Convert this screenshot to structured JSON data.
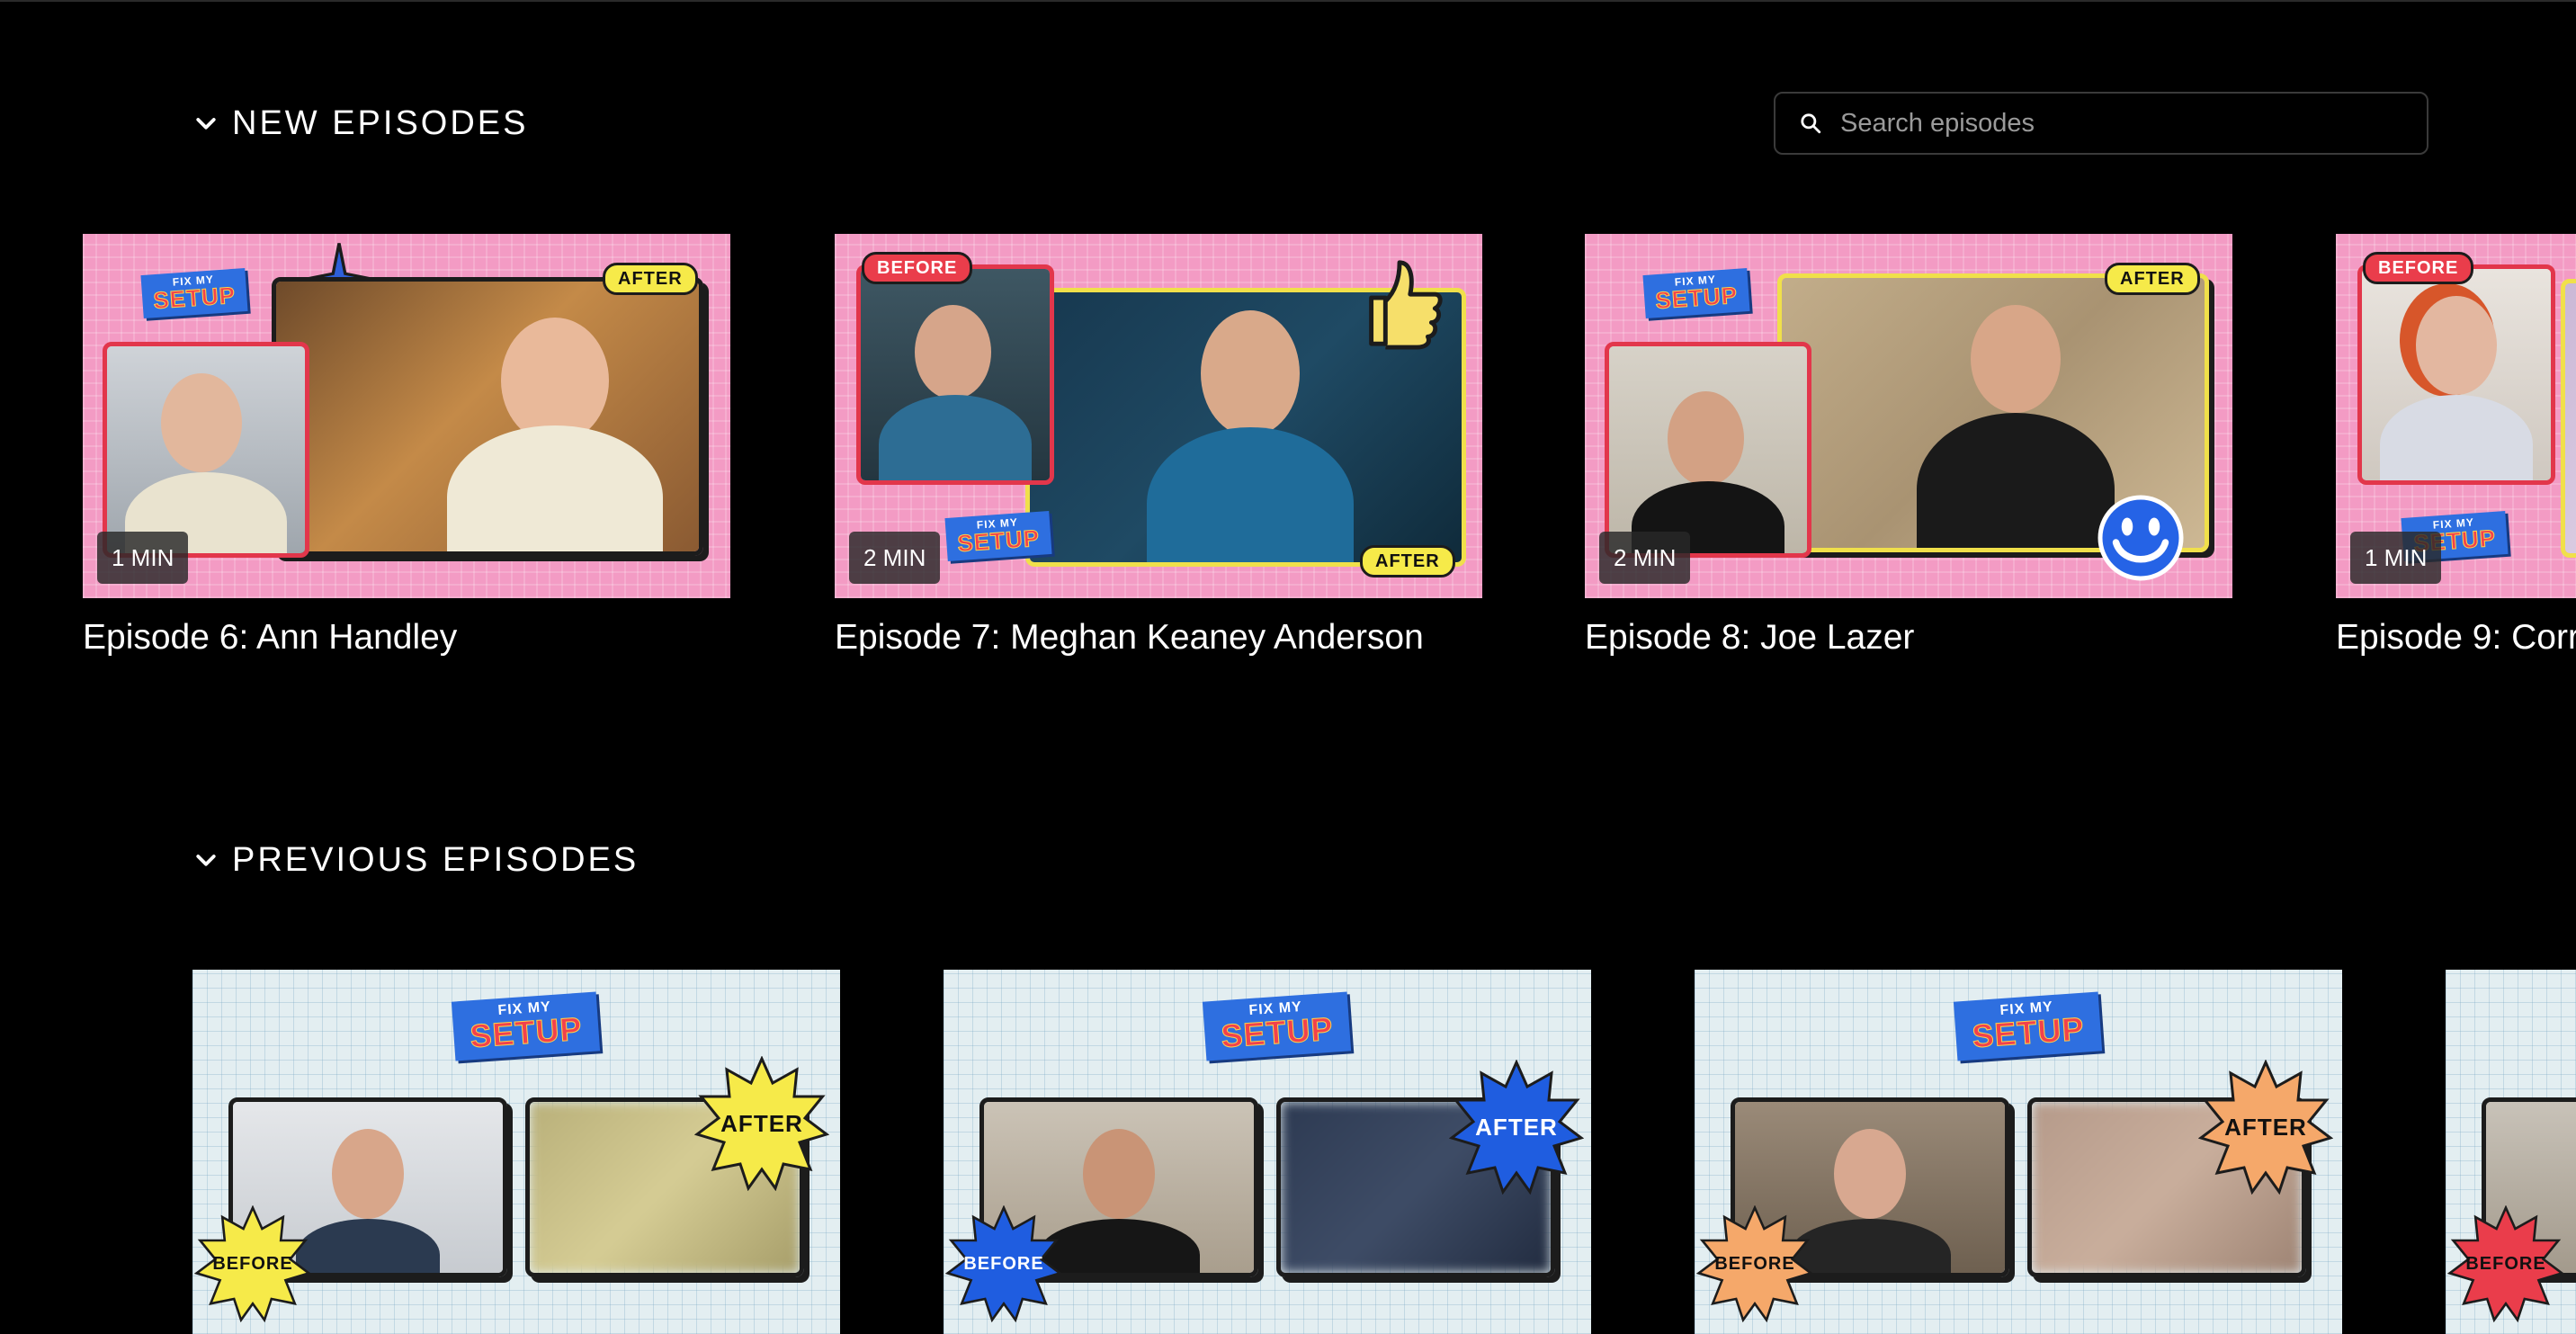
{
  "sections": {
    "new": {
      "title": "NEW EPISODES"
    },
    "previous": {
      "title": "PREVIOUS EPISODES"
    }
  },
  "search": {
    "placeholder": "Search episodes"
  },
  "new_episodes": [
    {
      "title": "Episode 6: Ann Handley",
      "duration": "1 MIN",
      "badge": "AFTER"
    },
    {
      "title": "Episode 7: Meghan Keaney Anderson",
      "duration": "2 MIN",
      "badge_top": "BEFORE",
      "badge_bottom": "AFTER"
    },
    {
      "title": "Episode 8: Joe Lazer",
      "duration": "2 MIN",
      "badge": "AFTER"
    },
    {
      "title": "Episode 9: Corr",
      "duration": "1 MIN",
      "badge": "BEFORE"
    }
  ],
  "previous_episodes": [
    {
      "before": "BEFORE",
      "after": "AFTER"
    },
    {
      "before": "BEFORE",
      "after": "AFTER"
    },
    {
      "before": "BEFORE",
      "after": "AFTER"
    },
    {
      "before": "BEFORE"
    }
  ],
  "logo": {
    "line1": "FIX MY",
    "line2": "SETUP"
  },
  "colors": {
    "background": "#000000",
    "pink": "#f39bc4",
    "after_yellow": "#f6ea49",
    "before_red": "#ea3d4b",
    "blue": "#1f5de0",
    "peach": "#f5a86a"
  }
}
